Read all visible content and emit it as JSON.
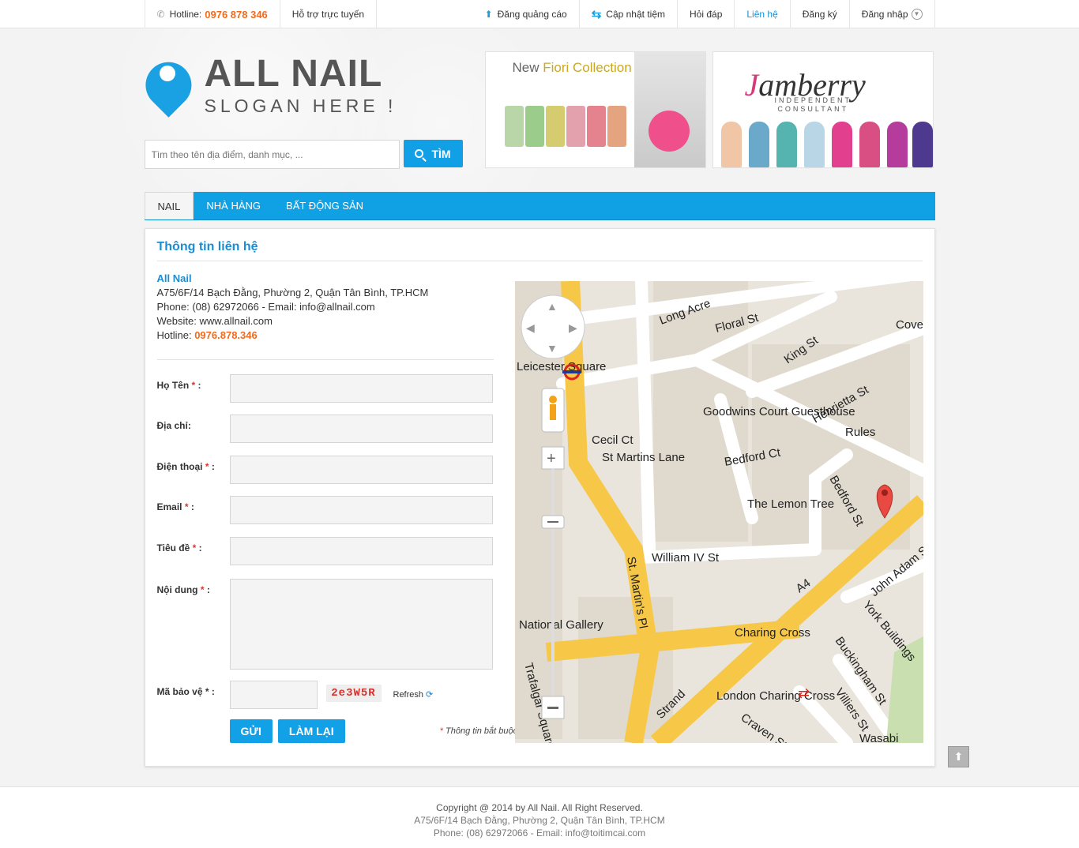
{
  "topbar": {
    "hotline_label": "Hotline:",
    "hotline_number": "0976 878 346",
    "support": "Hỗ trợ trực tuyến",
    "post_ad": "Đăng quảng cáo",
    "update_shop": "Cập nhật tiệm",
    "faq": "Hỏi đáp",
    "contact": "Liên hệ",
    "register": "Đăng ký",
    "login": "Đăng nhập"
  },
  "brand": {
    "name": "ALL NAIL",
    "slogan": "SLOGAN HERE !"
  },
  "search": {
    "placeholder": "Tìm theo tên địa điểm, danh mục, ...",
    "button": "TÌM"
  },
  "ads": {
    "ad1_title_a": "New ",
    "ad1_title_b": "Fiori Collection",
    "ad2_brand_a": "J",
    "ad2_brand_b": "amberry",
    "ad2_sub1": "INDEPENDENT",
    "ad2_sub2": "CONSULTANT"
  },
  "nav": {
    "items": [
      "NAIL",
      "NHÀ HÀNG",
      "BẤT ĐỘNG SẢN"
    ]
  },
  "contact": {
    "title": "Thông tin liên hệ",
    "company": "All Nail",
    "address": "A75/6F/14 Bạch Đằng, Phường 2, Quận Tân Bình, TP.HCM",
    "phone_email": "Phone: (08) 62972066 - Email: info@allnail.com",
    "website": "Website: www.allnail.com",
    "hotline_label": "Hotline: ",
    "hotline": "0976.878.346"
  },
  "form": {
    "name_label": "Họ Tên",
    "address_label": "Địa chỉ:",
    "phone_label": "Điện thoại",
    "email_label": "Email",
    "subject_label": "Tiêu đề",
    "content_label": "Nội dung",
    "captcha_label": "Mã bảo vệ",
    "star": "*",
    "colon": " :",
    "captcha_code": "2e3W5R",
    "refresh": "Refresh",
    "send": "GỬI",
    "reset": "LÀM LẠI",
    "required_note": "Thông tin bắt buộc"
  },
  "map": {
    "labels": [
      "Long Acre",
      "Floral St",
      "Covent Garden",
      "King St",
      "Leicester Square",
      "Goodwins Court Guesthouse",
      "Henrietta St",
      "Rules",
      "Cecil Ct",
      "St Martins Lane",
      "Bedford Ct",
      "Bedford St",
      "The Lemon Tree",
      "William IV St",
      "St. Martin's Pl",
      "John Adam St",
      "York Buildings",
      "A4",
      "Charing Cross",
      "Buckingham St",
      "National Gallery",
      "London Charing Cross",
      "Villiers St",
      "Strand",
      "Trafalgar Square",
      "Craven St",
      "Wasabi"
    ]
  },
  "footer": {
    "copyright": "Copyright @ 2014 by All Nail. All Right Reserved.",
    "address": "A75/6F/14 Bạch Đằng, Phường 2, Quận Tân Bình, TP.HCM",
    "contact": "Phone: (08) 62972066 - Email: info@toitimcai.com"
  }
}
